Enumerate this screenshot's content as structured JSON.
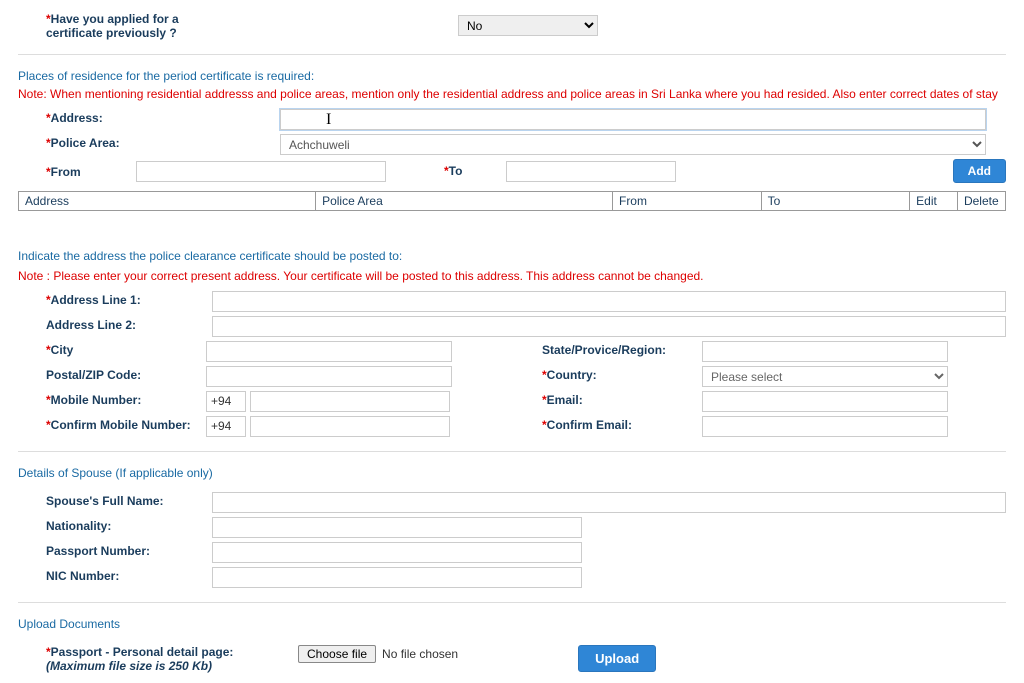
{
  "top": {
    "applied_prev_label": "Have you applied for a certificate previously ?",
    "applied_prev_value": "No"
  },
  "residence": {
    "heading": "Places of residence for the period certificate is required:",
    "note": "Note: When mentioning residential addresss and police areas, mention only the residential address and police areas in Sri Lanka where you had resided. Also enter correct dates of stay",
    "address_label": "Address:",
    "police_area_label": "Police Area:",
    "police_area_value": "Achchuweli",
    "from_label": "From",
    "to_label": "To",
    "add_button": "Add",
    "table": {
      "col_address": "Address",
      "col_police": "Police Area",
      "col_from": "From",
      "col_to": "To",
      "col_edit": "Edit",
      "col_delete": "Delete"
    }
  },
  "posting": {
    "heading": "Indicate the address the police clearance certificate should be posted to:",
    "note": "Note : Please enter your correct present address. Your certificate will be posted to this address. This address cannot be changed.",
    "addr1": "Address Line 1:",
    "addr2": "Address Line 2:",
    "city": "City",
    "state": "State/Provice/Region:",
    "postal": "Postal/ZIP Code:",
    "country": "Country:",
    "country_value": "Please select",
    "mobile": "Mobile Number:",
    "email": "Email:",
    "confirm_mobile": "Confirm Mobile Number:",
    "confirm_email": "Confirm Email:",
    "phone_prefix": "+94"
  },
  "spouse": {
    "heading": "Details of Spouse (If applicable only)",
    "fullname": "Spouse's Full Name:",
    "nationality": "Nationality:",
    "passport": "Passport Number:",
    "nic": "NIC Number:"
  },
  "upload": {
    "heading": "Upload Documents",
    "passport_label": "Passport - Personal detail page:",
    "max_size": "(Maximum file size is 250 Kb)",
    "choose_file": "Choose file",
    "no_file": "No file chosen",
    "upload_btn": "Upload"
  }
}
